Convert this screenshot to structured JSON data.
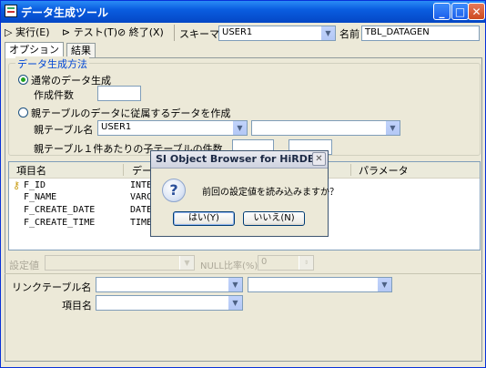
{
  "window": {
    "title": "データ生成ツール",
    "controls": {
      "minimize": "_",
      "maximize": "□",
      "close": "✕"
    }
  },
  "toolbar": {
    "run_label": "実行(E)",
    "test_label": "テスト(T)",
    "exit_label": "終了(X)",
    "schema_label": "スキーマ",
    "schema_value": "USER1",
    "name_label": "名前",
    "name_value": "TBL_DATAGEN"
  },
  "tabs": [
    {
      "label": "オプション",
      "active": true
    },
    {
      "label": "結果",
      "active": false
    }
  ],
  "generation": {
    "group_label": "データ生成方法",
    "normal_label": "通常のデータ生成",
    "count_label": "作成件数",
    "count_value": "",
    "dependent_label": "親テーブルのデータに従属するデータを作成",
    "parent_table_label": "親テーブル名",
    "parent_schema_value": "USER1",
    "parent_table_value": "",
    "per_row_label": "親テーブル１件あたりの子テーブルの件数"
  },
  "grid": {
    "columns": [
      "項目名",
      "データ型",
      "パラメータ"
    ],
    "rows": [
      {
        "name": "F_ID",
        "type": "INTE",
        "key": true
      },
      {
        "name": "F_NAME",
        "type": "VARC",
        "key": false
      },
      {
        "name": "F_CREATE_DATE",
        "type": "DATE",
        "key": false
      },
      {
        "name": "F_CREATE_TIME",
        "type": "TIME",
        "key": false
      }
    ]
  },
  "bottom": {
    "setting_label": "設定値",
    "null_ratio_label": "NULL比率(%)",
    "null_ratio_value": "0",
    "link_table_label": "リンクテーブル名",
    "field_label": "項目名"
  },
  "dialog": {
    "title": "SI Object Browser for HiRDB",
    "message": "前回の設定値を読み込みますか？",
    "yes_label": "はい(Y)",
    "no_label": "いいえ(N)",
    "close": "✕"
  },
  "icons": [
    "app-icon",
    "run-icon",
    "test-icon",
    "exit-icon",
    "key-icon",
    "question-icon"
  ]
}
